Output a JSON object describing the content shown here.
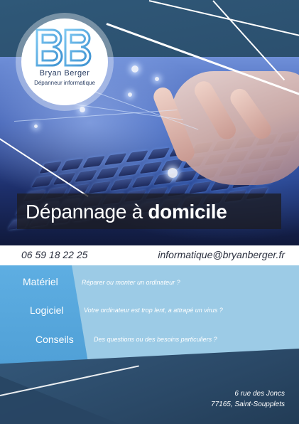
{
  "logo": {
    "name": "Bryan Berger",
    "subtitle": "Dépanneur informatique"
  },
  "banner": {
    "text_normal": "Dépannage à",
    "text_bold": "domicile"
  },
  "contact": {
    "phone": "06 59 18 22 25",
    "email": "informatique@bryanberger.fr"
  },
  "services": [
    {
      "label": "Matériel",
      "description": "Réparer ou monter un ordinateur ?"
    },
    {
      "label": "Logiciel",
      "description": "Votre ordinateur est trop lent, a attrapé un virus ?"
    },
    {
      "label": "Conseils",
      "description": "Des questions ou des besoins particuliers ?"
    }
  ],
  "address": {
    "line1": "6 rue des Joncs",
    "line2": "77165, Saint-Soupplets"
  },
  "colors": {
    "background": "#2d4c66",
    "services_light": "#9ccbe6",
    "services_accent": "#5eaee2",
    "banner": "#1c1c22",
    "text_dark": "#2a2f3e"
  }
}
